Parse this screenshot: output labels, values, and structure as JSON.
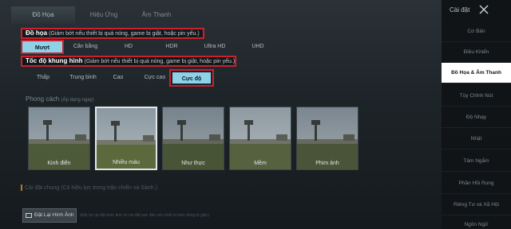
{
  "tabs": [
    {
      "label": "Đồ Họa",
      "active": true
    },
    {
      "label": "Hiệu Ứng",
      "active": false
    },
    {
      "label": "Âm Thanh",
      "active": false
    }
  ],
  "graphics": {
    "title": "Đồ họa",
    "hint": "(Giảm bớt nếu thiết bị quá nóng, game bị giật, hoặc pin yếu.)",
    "options": [
      "Mượt",
      "Cân bằng",
      "HD",
      "HDR",
      "Ultra HD",
      "UHD"
    ],
    "selected": "Mượt"
  },
  "framerate": {
    "title": "Tốc độ khung hình",
    "hint": "(Giảm bớt nếu thiết bị quá nóng, game bị giật, hoặc pin yếu.)",
    "options": [
      "Thấp",
      "Trung bình",
      "Cao",
      "Cực cao",
      "Cực độ"
    ],
    "selected": "Cực độ"
  },
  "style": {
    "label": "Phong cách",
    "sub": "(Áp dụng ngay)",
    "cards": [
      {
        "label": "Kinh điển",
        "selected": false
      },
      {
        "label": "Nhiều màu",
        "selected": true
      },
      {
        "label": "Như thực",
        "selected": false
      },
      {
        "label": "Mềm",
        "selected": false
      },
      {
        "label": "Phim ảnh",
        "selected": false
      }
    ]
  },
  "common": {
    "label": "Cài đặt chung (Có hiệu lực trong trận chiến và Sảnh.)"
  },
  "reset": {
    "label": "Đặt Lại Hình Ảnh",
    "note": "(Đặt lại cài đặt hình ảnh về cài đặt ban đầu nếu thiết bị hiện đang bị giật.)"
  },
  "sidebar": {
    "title": "Cài đặt",
    "items": [
      {
        "label": "Cơ Bản",
        "active": false
      },
      {
        "label": "Điều Khiển",
        "active": false
      },
      {
        "label": "Đồ Họa & Âm Thanh",
        "active": true
      },
      {
        "label": "Tùy Chỉnh Nút",
        "active": false
      },
      {
        "label": "Độ Nhạy",
        "active": false
      },
      {
        "label": "Nhặt",
        "active": false
      },
      {
        "label": "Tâm Ngắm",
        "active": false
      },
      {
        "label": "Phần Hồi Rung",
        "active": false
      },
      {
        "label": "Riêng Tư và Xã Hội",
        "active": false
      },
      {
        "label": "Ngôn Ngữ",
        "active": false
      }
    ]
  },
  "colors": {
    "accent": "#8ed2e8",
    "highlight_border": "#c8222f",
    "sidebar_bg": "#101417"
  }
}
